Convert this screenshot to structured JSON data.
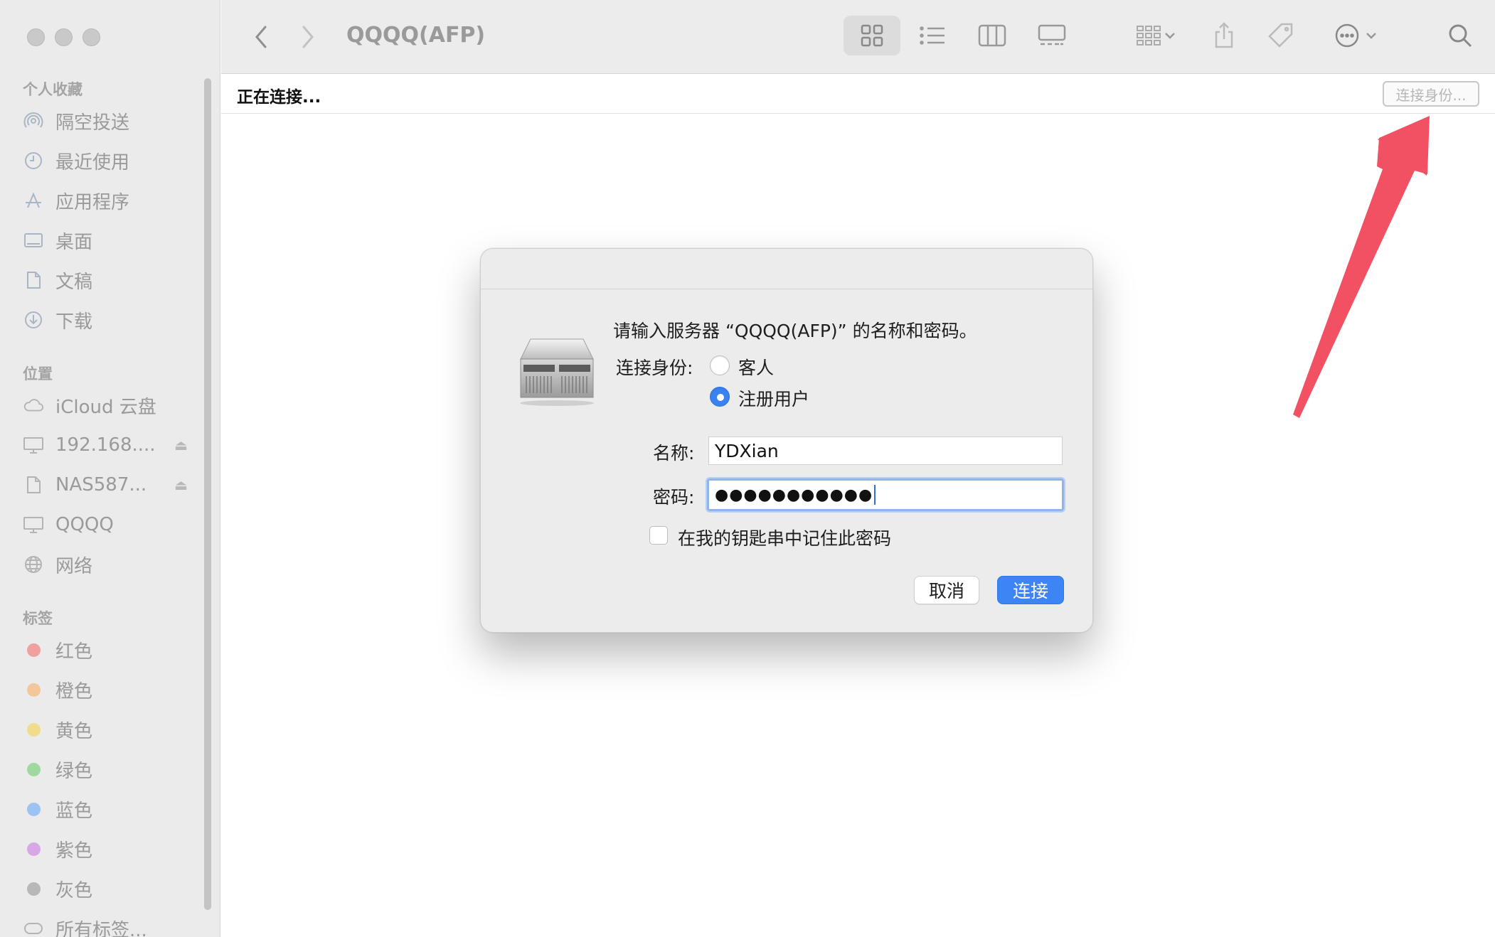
{
  "window": {
    "title": "QQQQ(AFP)"
  },
  "sidebar": {
    "favorites_title": "个人收藏",
    "favorites": [
      {
        "label": "隔空投送",
        "icon": "airdrop-icon"
      },
      {
        "label": "最近使用",
        "icon": "clock-icon"
      },
      {
        "label": "应用程序",
        "icon": "applications-icon"
      },
      {
        "label": "桌面",
        "icon": "desktop-icon"
      },
      {
        "label": "文稿",
        "icon": "document-icon"
      },
      {
        "label": "下载",
        "icon": "download-icon"
      }
    ],
    "locations_title": "位置",
    "locations": [
      {
        "label": "iCloud 云盘",
        "icon": "cloud-icon"
      },
      {
        "label": "192.168....",
        "icon": "monitor-icon",
        "eject": true
      },
      {
        "label": "NAS587...",
        "icon": "document-icon",
        "eject": true
      },
      {
        "label": "QQQQ",
        "icon": "monitor-icon"
      },
      {
        "label": "网络",
        "icon": "globe-icon"
      }
    ],
    "tags_title": "标签",
    "tags": [
      {
        "label": "红色",
        "color": "#f0a0a0"
      },
      {
        "label": "橙色",
        "color": "#f2c79b"
      },
      {
        "label": "黄色",
        "color": "#f0dc8f"
      },
      {
        "label": "绿色",
        "color": "#9fd8a0"
      },
      {
        "label": "蓝色",
        "color": "#9cc3f2"
      },
      {
        "label": "紫色",
        "color": "#d8a8e6"
      },
      {
        "label": "灰色",
        "color": "#b8b8b8"
      },
      {
        "label": "所有标签...",
        "color": "none"
      }
    ],
    "eject_symbol": "⏏"
  },
  "status": {
    "text": "正在连接...",
    "connect_as_button": "连接身份..."
  },
  "dialog": {
    "prompt": "请输入服务器 “QQQQ(AFP)” 的名称和密码。",
    "connect_as_label": "连接身份:",
    "guest_label": "客人",
    "registered_label": "注册用户",
    "selected_role": "注册用户",
    "name_label": "名称:",
    "name_value": "YDXian",
    "password_label": "密码:",
    "password_value": "●●●●●●●●●●●",
    "remember_label": "在我的钥匙串中记住此密码",
    "remember_checked": false,
    "cancel_button": "取消",
    "connect_button": "连接"
  },
  "colors": {
    "accent": "#3d85f5",
    "annotation_arrow": "#f25063"
  }
}
